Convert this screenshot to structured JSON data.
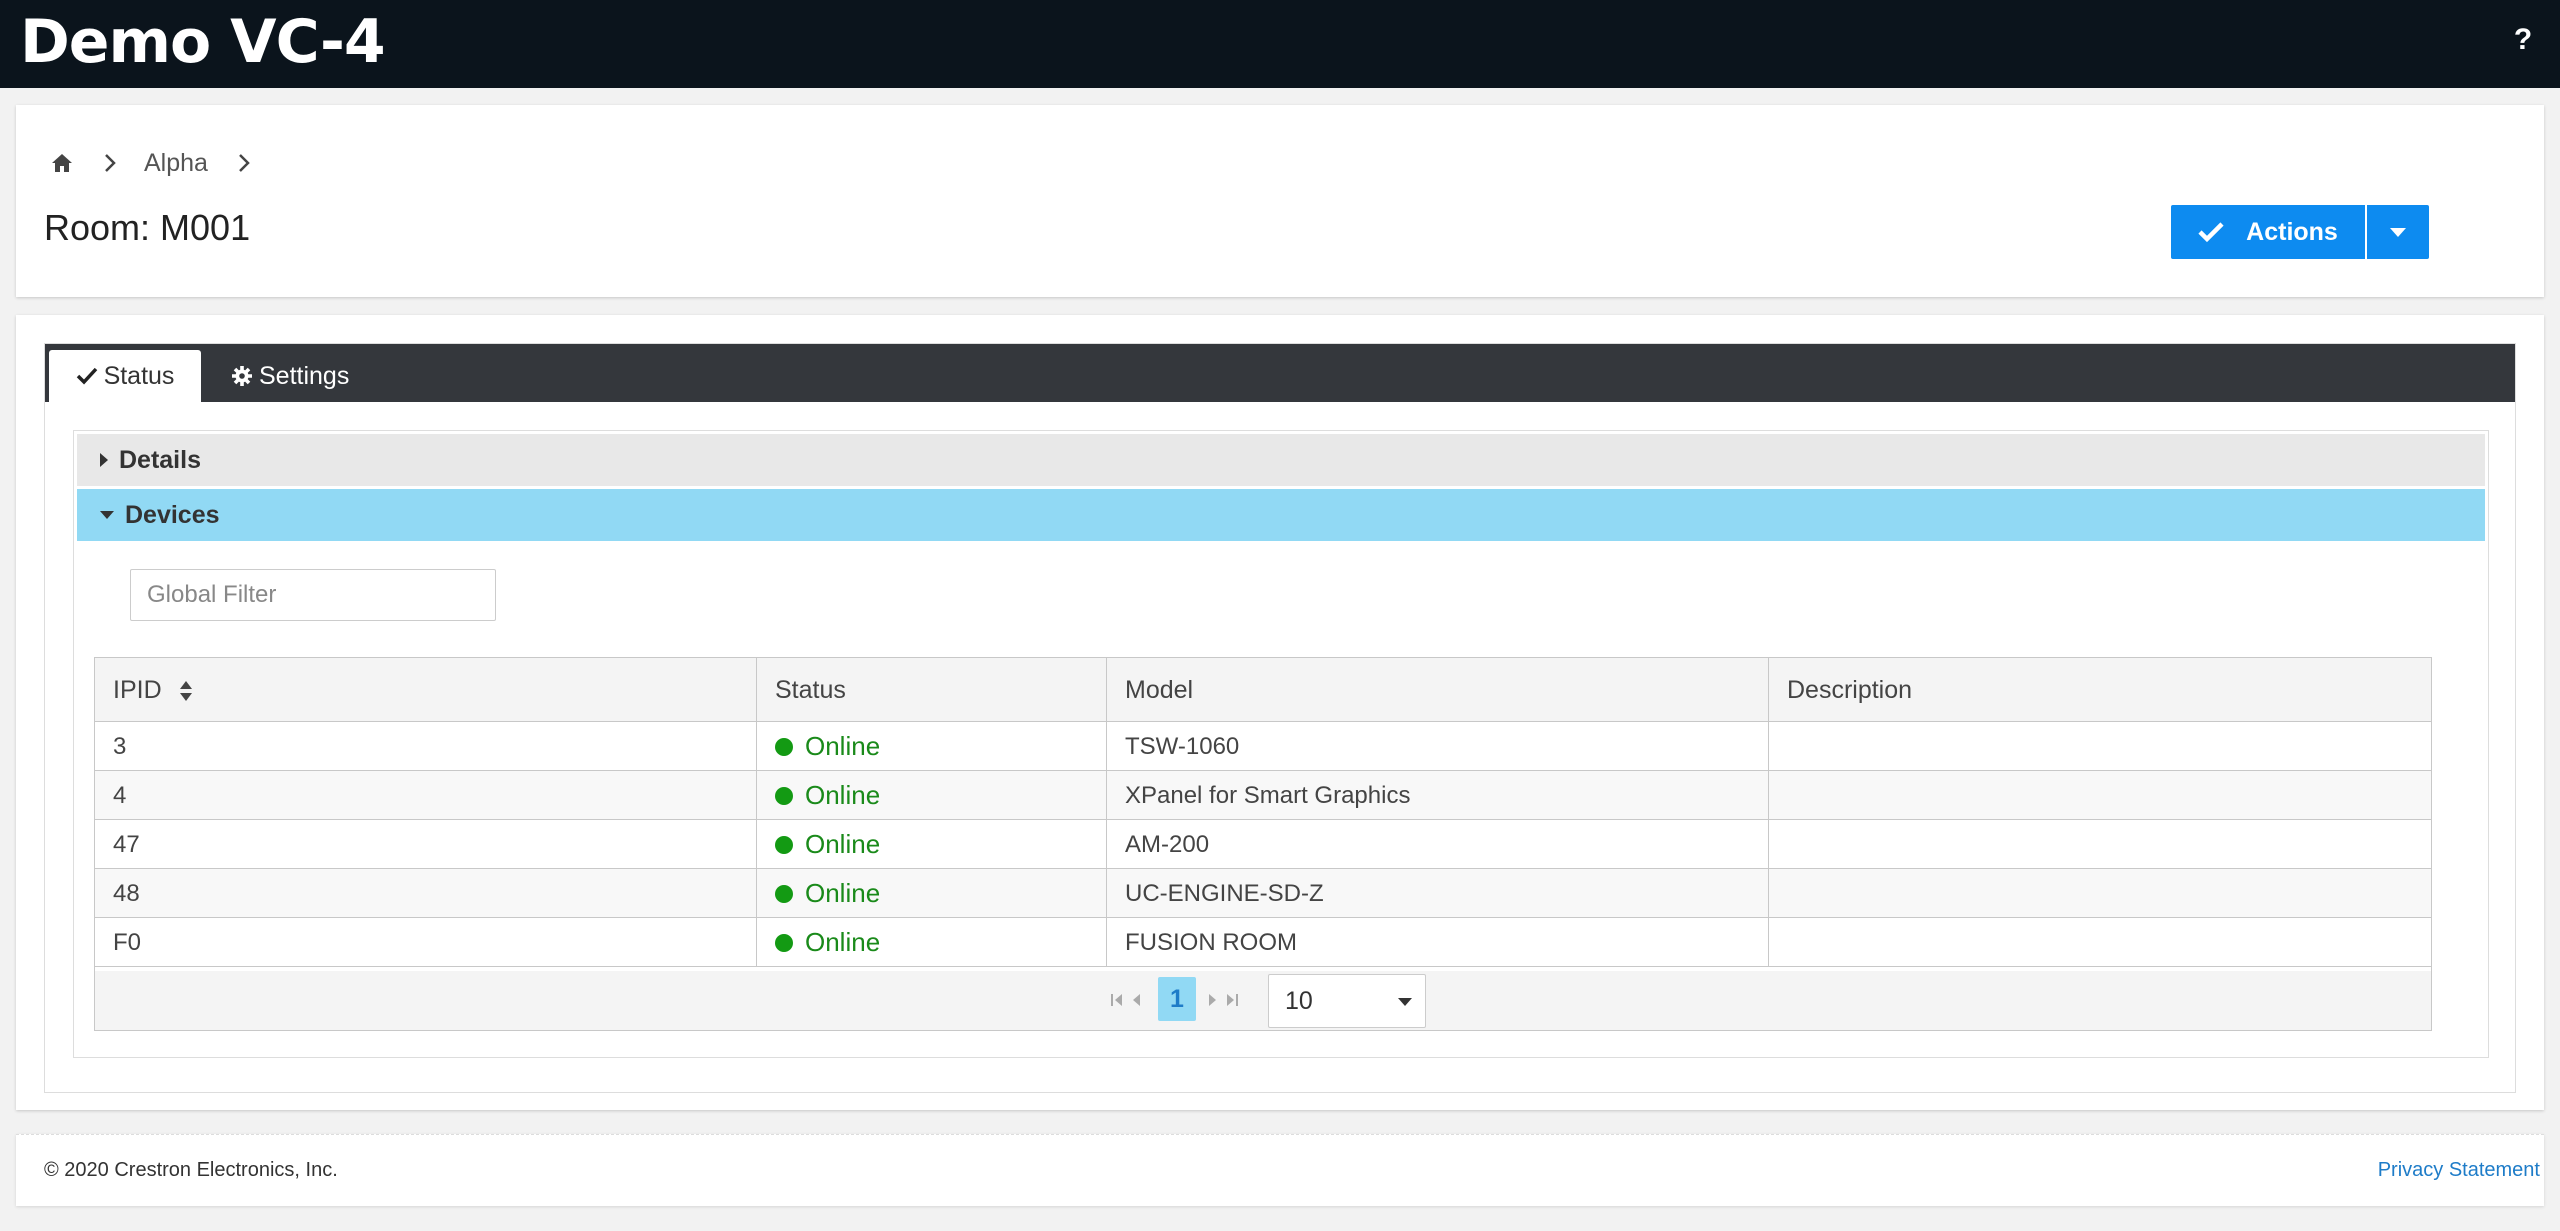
{
  "app": {
    "title": "Demo VC-4",
    "help_label": "?"
  },
  "breadcrumb": {
    "home_icon": "home-icon",
    "items": [
      "Alpha"
    ]
  },
  "page": {
    "title": "Room: M001"
  },
  "actions": {
    "label": "Actions",
    "icon": "check-icon",
    "dropdown_icon": "caret-down-icon",
    "color": "#0d8bf0"
  },
  "tabs": [
    {
      "label": "Status",
      "icon": "check-icon",
      "active": true
    },
    {
      "label": "Settings",
      "icon": "gear-icon",
      "active": false
    }
  ],
  "accordion": {
    "details": {
      "label": "Details",
      "expanded": false
    },
    "devices": {
      "label": "Devices",
      "expanded": true
    }
  },
  "filter": {
    "placeholder": "Global Filter",
    "value": ""
  },
  "table": {
    "columns": [
      "IPID",
      "Status",
      "Model",
      "Description"
    ],
    "rows": [
      {
        "ipid": "3",
        "status": "Online",
        "model": "TSW-1060",
        "description": ""
      },
      {
        "ipid": "4",
        "status": "Online",
        "model": "XPanel for Smart Graphics",
        "description": ""
      },
      {
        "ipid": "47",
        "status": "Online",
        "model": "AM-200",
        "description": ""
      },
      {
        "ipid": "48",
        "status": "Online",
        "model": "UC-ENGINE-SD-Z",
        "description": ""
      },
      {
        "ipid": "F0",
        "status": "Online",
        "model": "FUSION ROOM",
        "description": ""
      }
    ],
    "status_color": "#139a13"
  },
  "paginator": {
    "current_page": "1",
    "rows_per_page": "10"
  },
  "footer": {
    "copyright": "© 2020 Crestron Electronics, Inc.",
    "privacy": "Privacy Statement"
  }
}
